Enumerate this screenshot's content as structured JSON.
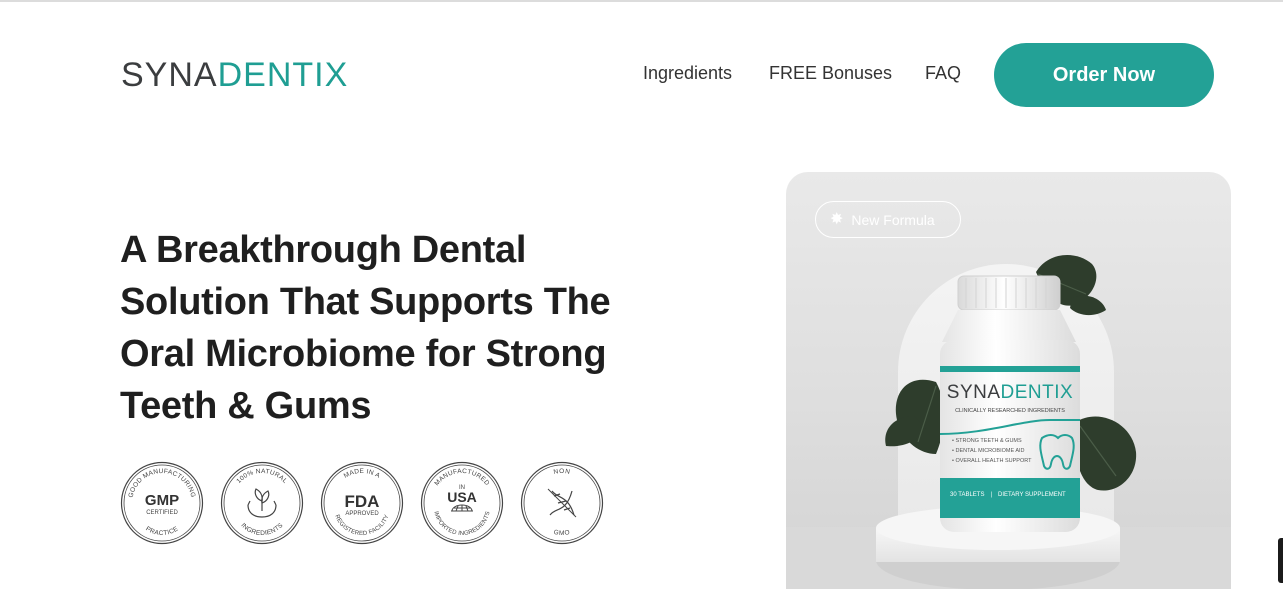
{
  "header": {
    "logo_part1": "SYNA",
    "logo_part2": "DENTIX",
    "nav": {
      "ingredients": "Ingredients",
      "bonuses": "FREE Bonuses",
      "faq": "FAQ"
    },
    "order_button": "Order Now"
  },
  "hero": {
    "title": "A Breakthrough Dental Solution That Supports The Oral Microbiome for Strong Teeth & Gums"
  },
  "badges": [
    {
      "top": "GOOD MANUFACTURING",
      "main": "GMP",
      "sub": "CERTIFIED",
      "bottom": "PRACTICE",
      "icon": "gmp-icon"
    },
    {
      "top": "100% NATURAL",
      "main": "",
      "sub": "",
      "bottom": "INGREDIENTS",
      "icon": "hands-leaf-icon"
    },
    {
      "top": "MADE IN A",
      "main": "FDA",
      "sub": "APPROVED",
      "bottom": "REGISTERED FACILITY",
      "icon": "fda-icon"
    },
    {
      "top": "MANUFACTURED",
      "main": "USA",
      "sub": "IN",
      "bottom": "IMPORTED INGREDIENTS",
      "icon": "globe-icon"
    },
    {
      "top": "NON",
      "main": "",
      "sub": "",
      "bottom": "GMO",
      "icon": "dna-icon"
    }
  ],
  "product_card": {
    "pill": "New Formula",
    "bottle": {
      "brand_part1": "SYNA",
      "brand_part2": "DENTIX",
      "tagline": "CLINICALLY RESEARCHED INGREDIENTS",
      "bullets": [
        "STRONG TEETH & GUMS",
        "DENTAL MICROBIOME AID",
        "OVERALL HEALTH SUPPORT"
      ],
      "count": "30 TABLETS",
      "type": "DIETARY SUPPLEMENT"
    }
  },
  "colors": {
    "accent": "#23a196",
    "logo_dark": "#3b3d3f",
    "title": "#1f1f1f"
  }
}
